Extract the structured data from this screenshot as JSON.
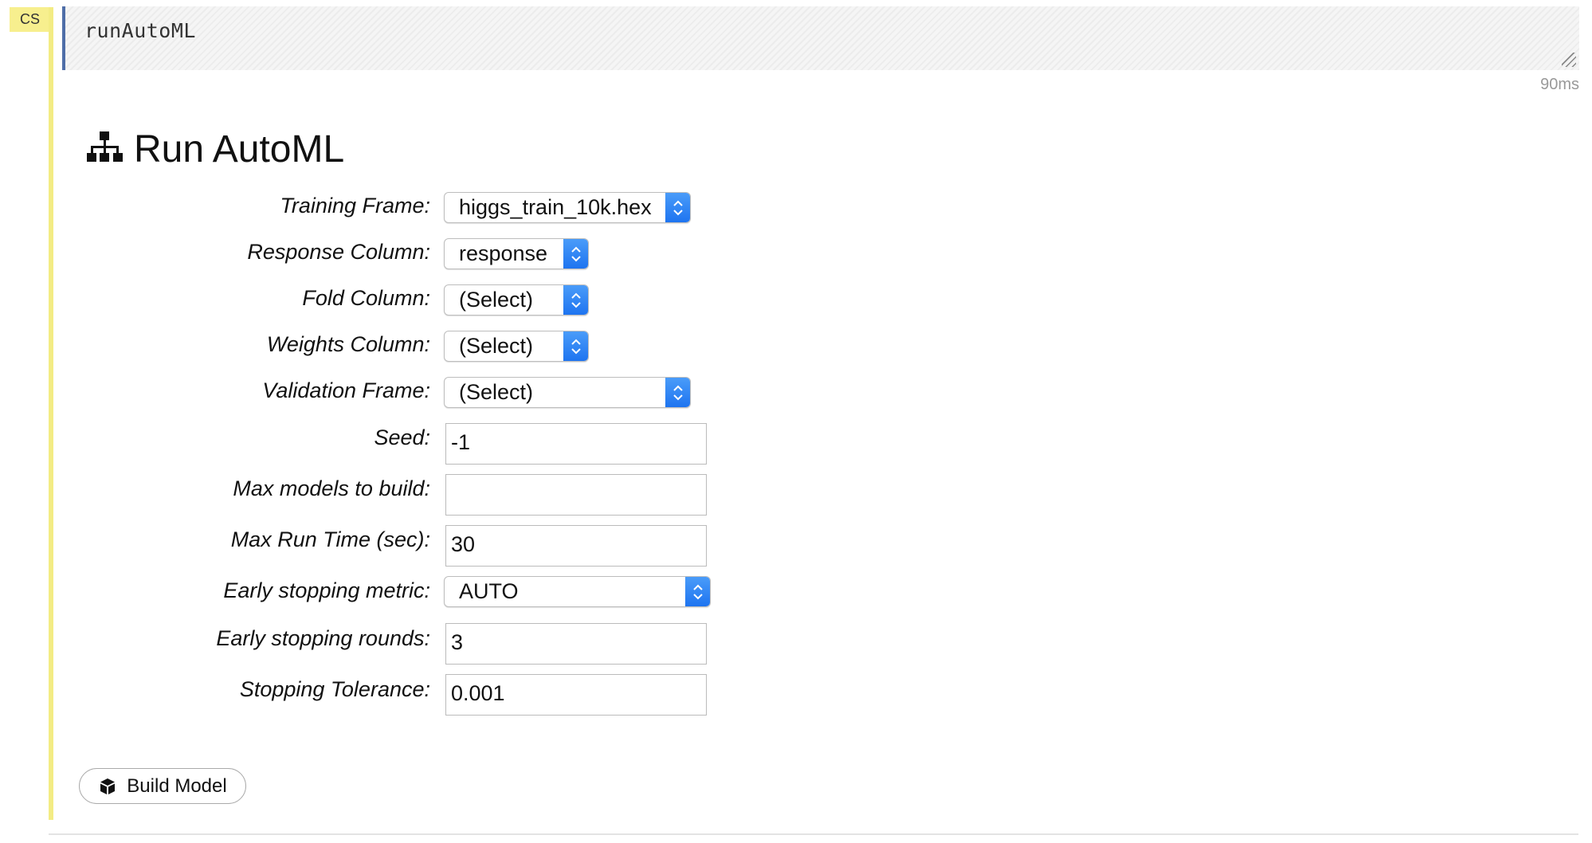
{
  "cell": {
    "type_badge": "CS",
    "code": "runAutoML",
    "timing": "90ms"
  },
  "heading": {
    "icon": "sitemap-icon",
    "title": "Run AutoML"
  },
  "form": {
    "training_frame": {
      "label": "Training Frame:",
      "value": "higgs_train_10k.hex"
    },
    "response_column": {
      "label": "Response Column:",
      "value": "response"
    },
    "fold_column": {
      "label": "Fold Column:",
      "value": "(Select)"
    },
    "weights_column": {
      "label": "Weights Column:",
      "value": "(Select)"
    },
    "validation_frame": {
      "label": "Validation Frame:",
      "value": "(Select)"
    },
    "seed": {
      "label": "Seed:",
      "value": "-1"
    },
    "max_models": {
      "label": "Max models to build:",
      "value": ""
    },
    "max_run_time": {
      "label": "Max Run Time (sec):",
      "value": "30"
    },
    "stopping_metric": {
      "label": "Early stopping metric:",
      "value": "AUTO"
    },
    "stopping_rounds": {
      "label": "Early stopping rounds:",
      "value": "3"
    },
    "stopping_tolerance": {
      "label": "Stopping Tolerance:",
      "value": "0.001"
    }
  },
  "actions": {
    "build_label": "Build Model",
    "build_icon": "cube-icon"
  },
  "colors": {
    "cell_accent": "#f3ec84",
    "select_arrow": "#2a7ff5",
    "editor_border": "#4f6ea8"
  }
}
